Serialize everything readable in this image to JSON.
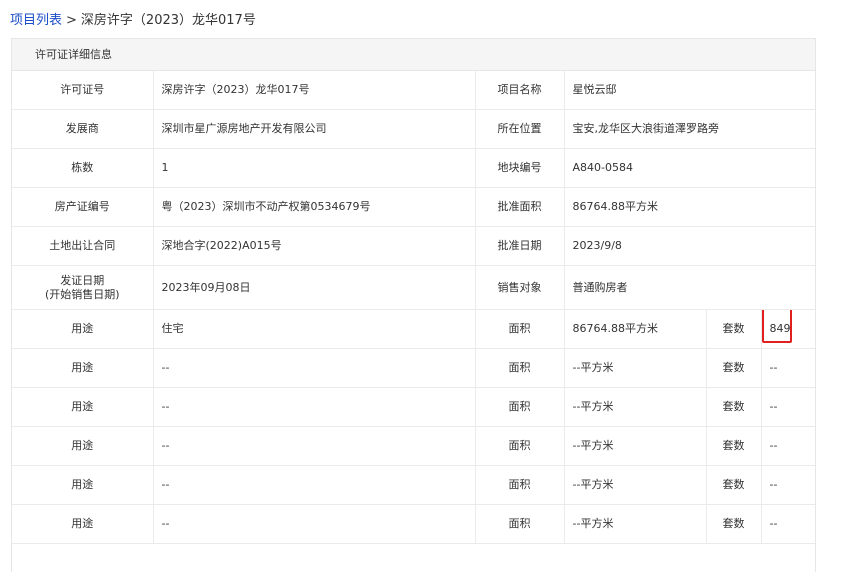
{
  "breadcrumb": {
    "link_label": "项目列表",
    "separator": ">",
    "current": "深房许字（2023）龙华017号"
  },
  "panel": {
    "title": "许可证详细信息"
  },
  "details": {
    "rows": [
      {
        "label1": "许可证号",
        "value1": "深房许字（2023）龙华017号",
        "label2": "项目名称",
        "value2": "星悦云邸"
      },
      {
        "label1": "发展商",
        "value1": "深圳市星广源房地产开发有限公司",
        "label2": "所在位置",
        "value2": "宝安,龙华区大浪街道澤罗路旁"
      },
      {
        "label1": "栋数",
        "value1": "1",
        "label2": "地块编号",
        "value2": "A840-0584"
      },
      {
        "label1": "房产证编号",
        "value1": "粤（2023）深圳市不动产权第0534679号",
        "label2": "批准面积",
        "value2": "86764.88平方米"
      },
      {
        "label1": "土地出让合同",
        "value1": "深地合字(2022)A015号",
        "label2": "批准日期",
        "value2": "2023/9/8"
      },
      {
        "label1a": "发证日期",
        "label1b": "(开始销售日期)",
        "value1": "2023年09月08日",
        "label2": "销售对象",
        "value2": "普通购房者"
      }
    ],
    "usage_rows": [
      {
        "label_use": "用途",
        "use": "住宅",
        "label_area": "面积",
        "area": "86764.88平方米",
        "label_count": "套数",
        "count": "849"
      },
      {
        "label_use": "用途",
        "use": "--",
        "label_area": "面积",
        "area": "--平方米",
        "label_count": "套数",
        "count": "--"
      },
      {
        "label_use": "用途",
        "use": "--",
        "label_area": "面积",
        "area": "--平方米",
        "label_count": "套数",
        "count": "--"
      },
      {
        "label_use": "用途",
        "use": "--",
        "label_area": "面积",
        "area": "--平方米",
        "label_count": "套数",
        "count": "--"
      },
      {
        "label_use": "用途",
        "use": "--",
        "label_area": "面积",
        "area": "--平方米",
        "label_count": "套数",
        "count": "--"
      },
      {
        "label_use": "用途",
        "use": "--",
        "label_area": "面积",
        "area": "--平方米",
        "label_count": "套数",
        "count": "--"
      }
    ]
  },
  "colors": {
    "link": "#1a4dc8",
    "highlight_border": "#e02020",
    "header_bg": "#f5f5f5"
  }
}
